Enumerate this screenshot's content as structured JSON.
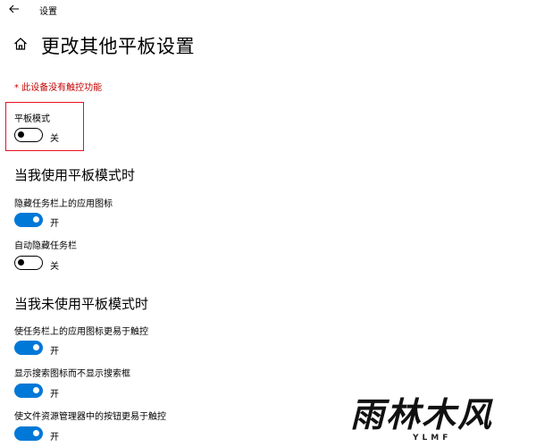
{
  "window": {
    "title": "设置"
  },
  "page": {
    "title": "更改其他平板设置"
  },
  "warning": "* 此设备没有触控功能",
  "tablet_mode": {
    "label": "平板模式",
    "state": "关",
    "on": false
  },
  "section_tablet": {
    "heading": "当我使用平板模式时",
    "settings": [
      {
        "label": "隐藏任务栏上的应用图标",
        "state": "开",
        "on": true
      },
      {
        "label": "自动隐藏任务栏",
        "state": "关",
        "on": false
      }
    ]
  },
  "section_non_tablet": {
    "heading": "当我未使用平板模式时",
    "settings": [
      {
        "label": "使任务栏上的应用图标更易于触控",
        "state": "开",
        "on": true
      },
      {
        "label": "显示搜索图标而不显示搜索框",
        "state": "开",
        "on": true
      },
      {
        "label": "使文件资源管理器中的按钮更易于触控",
        "state": "开",
        "on": true
      }
    ]
  },
  "watermark": {
    "text": "雨林木风",
    "sub": "YLMF"
  },
  "colors": {
    "accent": "#0078d7",
    "highlight_border": "#e81123",
    "warning": "#c50000"
  }
}
